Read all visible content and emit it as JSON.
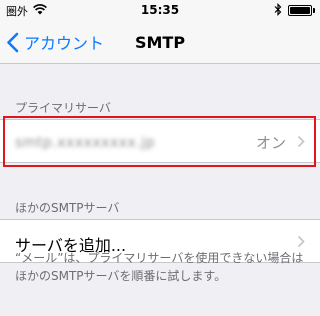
{
  "status_bar": {
    "carrier": "圏外",
    "time": "15:35"
  },
  "nav": {
    "back_label": "アカウント",
    "title": "SMTP"
  },
  "primary_section": {
    "header": "プライマリサーバ",
    "server": {
      "address": "smtp.xxxxxxxxx.jp",
      "status": "オン"
    }
  },
  "other_section": {
    "header": "ほかのSMTPサーバ",
    "add_label": "サーバを追加..."
  },
  "footer": "“メール”は、プライマリサーバを使用できない場合はほかのSMTPサーバを順番に試します。",
  "colors": {
    "accent": "#0a7aff",
    "highlight": "#e0161f",
    "background": "#efeff4"
  }
}
